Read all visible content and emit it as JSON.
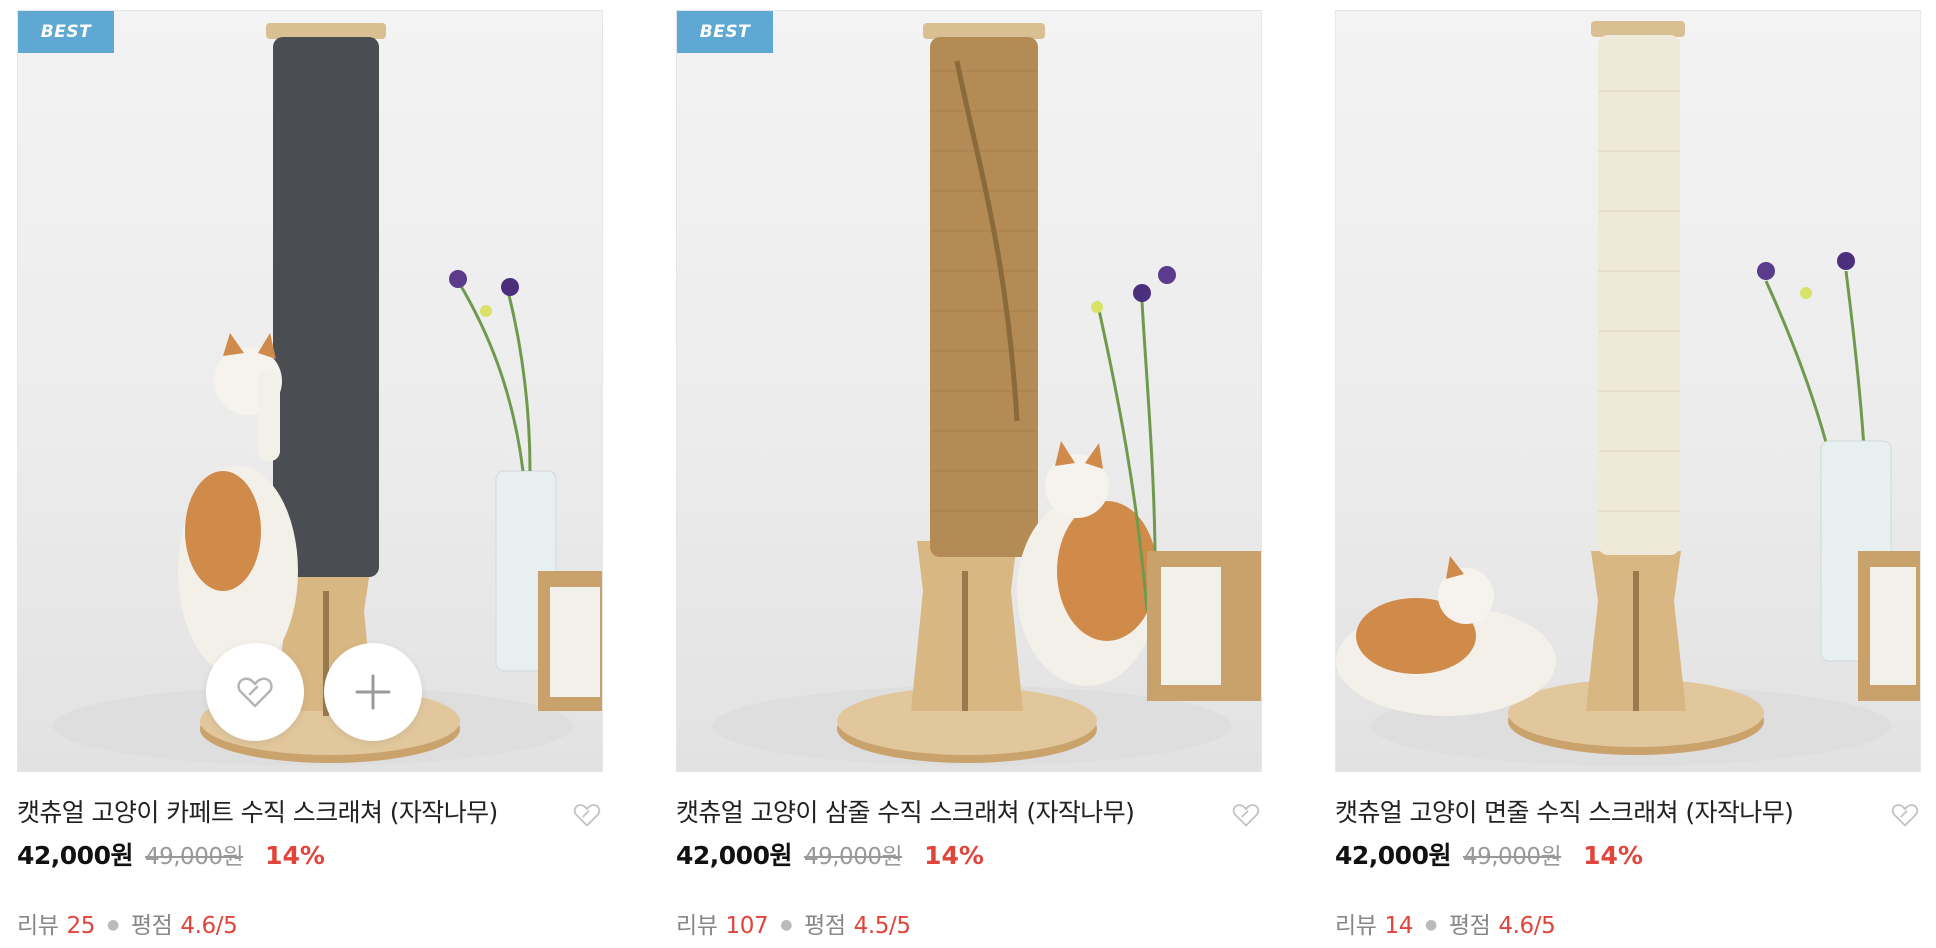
{
  "products": [
    {
      "badge": "BEST",
      "title": "캣츄얼 고양이 카페트 수직 스크래쳐 (자작나무)",
      "price": "42,000원",
      "original_price": "49,000원",
      "discount": "14%",
      "review_label": "리뷰",
      "review_count": "25",
      "rating_label": "평점",
      "rating": "4.6",
      "rating_sep": "/",
      "rating_max": "5",
      "post_color": "#4a4d52",
      "show_overlay": true
    },
    {
      "badge": "BEST",
      "title": "캣츄얼 고양이 삼줄 수직 스크래쳐 (자작나무)",
      "price": "42,000원",
      "original_price": "49,000원",
      "discount": "14%",
      "review_label": "리뷰",
      "review_count": "107",
      "rating_label": "평점",
      "rating": "4.5",
      "rating_sep": "/",
      "rating_max": "5",
      "post_color": "#b48a55",
      "show_overlay": false
    },
    {
      "badge": "",
      "title": "캣츄얼 고양이 면줄 수직 스크래쳐 (자작나무)",
      "price": "42,000원",
      "original_price": "49,000원",
      "discount": "14%",
      "review_label": "리뷰",
      "review_count": "14",
      "rating_label": "평점",
      "rating": "4.6",
      "rating_sep": "/",
      "rating_max": "5",
      "post_color": "#efe9da",
      "show_overlay": false
    }
  ],
  "icons": {
    "wishlist": "heart-tag-icon",
    "add": "plus-icon"
  },
  "colors": {
    "badge": "#5fa8d3",
    "discount": "#e0443a",
    "muted": "#888888"
  }
}
